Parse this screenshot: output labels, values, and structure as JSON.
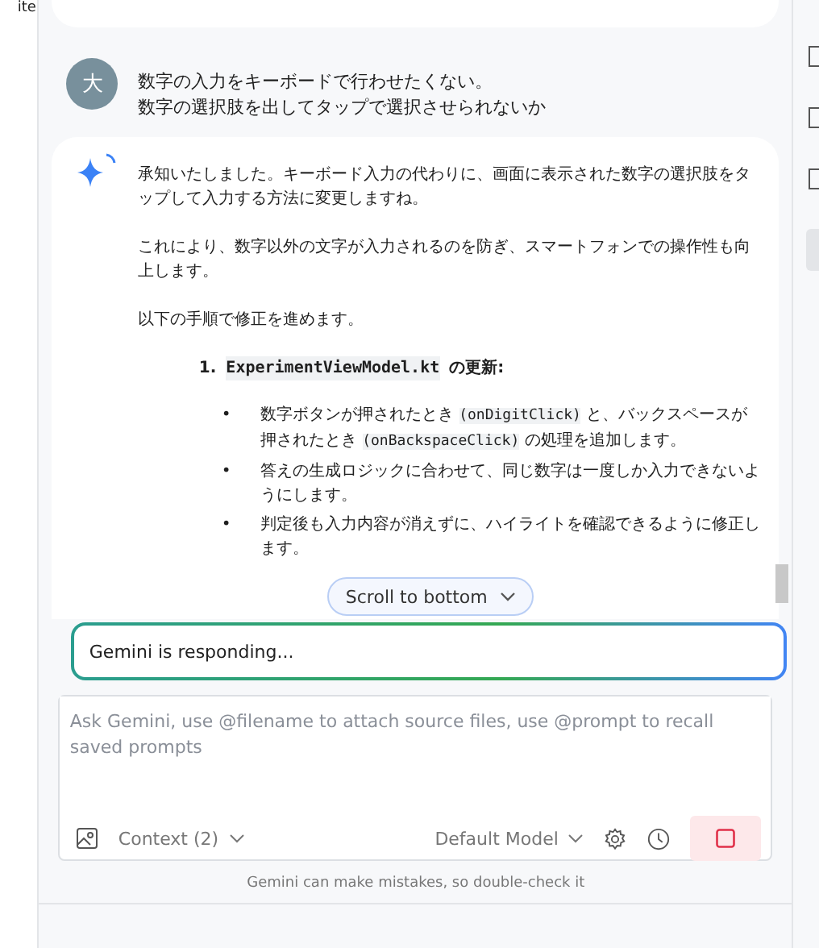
{
  "left_panel": {
    "text": "ite"
  },
  "user_message": {
    "avatar": "大",
    "lines": [
      "数字の入力をキーボードで行わせたくない。",
      "数字の選択肢を出してタップで選択させられないか"
    ]
  },
  "assistant_message": {
    "paragraphs": [
      "承知いたしました。キーボード入力の代わりに、画面に表示された数字の選択肢をタップして入力する方法に変更しますね。",
      "これにより、数字以外の文字が入力されるのを防ぎ、スマートフォンでの操作性も向上します。",
      "以下の手順で修正を進めます。"
    ],
    "steps": [
      {
        "number": "1.",
        "file": "ExperimentViewModel.kt",
        "label": "の更新:",
        "bullet": "•",
        "bullets": [
          [
            {
              "kind": "text",
              "text": "数字ボタンが押されたとき "
            },
            {
              "kind": "code",
              "text": "(onDigitClick)"
            },
            {
              "kind": "text",
              "text": " と、バックスペースが押されたとき "
            },
            {
              "kind": "code",
              "text": "(onBackspaceClick)"
            },
            {
              "kind": "text",
              "text": " の処理を追加します。"
            }
          ],
          [
            {
              "kind": "text",
              "text": "答えの生成ロジックに合わせて、同じ数字は一度しか入力できないようにします。"
            }
          ],
          [
            {
              "kind": "text",
              "text": "判定後も入力内容が消えずに、ハイライトを確認できるように修正します。"
            }
          ]
        ]
      }
    ]
  },
  "scroll_button": {
    "label": "Scroll to bottom"
  },
  "status_field": {
    "value": "Gemini is responding..."
  },
  "composer": {
    "placeholder": "Ask Gemini, use @filename to attach source files, use @prompt to recall saved prompts",
    "context": "Context (2)",
    "model": "Default Model"
  },
  "disclaimer": "Gemini can make mistakes, so double-check it"
}
